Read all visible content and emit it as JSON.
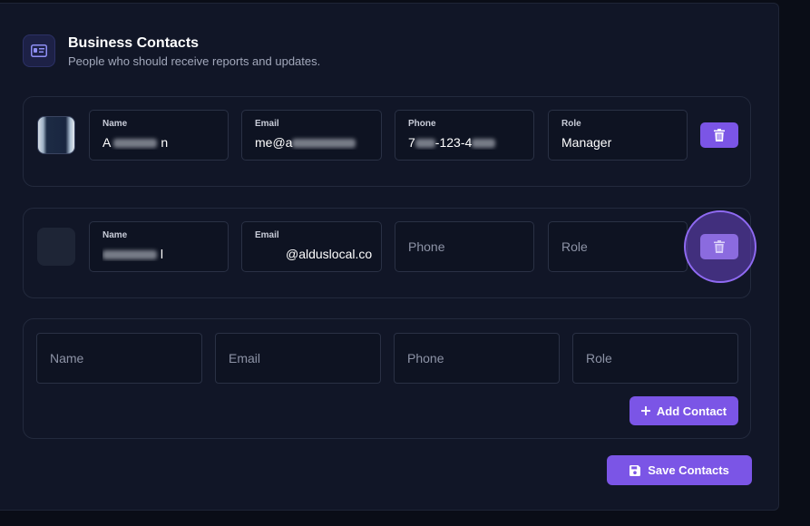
{
  "header": {
    "title": "Business Contacts",
    "subtitle": "People who should receive reports and updates.",
    "icon": "contact-card-icon"
  },
  "contacts": [
    {
      "name_label": "Name",
      "name_value": "A",
      "email_label": "Email",
      "email_value": "me@a",
      "phone_label": "Phone",
      "phone_value": "7",
      "phone_value_mid": "-12",
      "phone_value_end": "3-4",
      "role_label": "Role",
      "role_value": "Manager",
      "avatar": "photo"
    },
    {
      "name_label": "Name",
      "name_value": "l",
      "email_label": "Email",
      "email_value": "@alduslocal.co",
      "phone_placeholder": "Phone",
      "role_placeholder": "Role",
      "avatar": "empty"
    }
  ],
  "new_contact": {
    "name_placeholder": "Name",
    "email_placeholder": "Email",
    "phone_placeholder": "Phone",
    "role_placeholder": "Role",
    "add_label": "Add Contact"
  },
  "save_label": "Save Contacts",
  "colors": {
    "accent": "#7b55e6",
    "background": "#111627",
    "field": "#0e1322"
  }
}
